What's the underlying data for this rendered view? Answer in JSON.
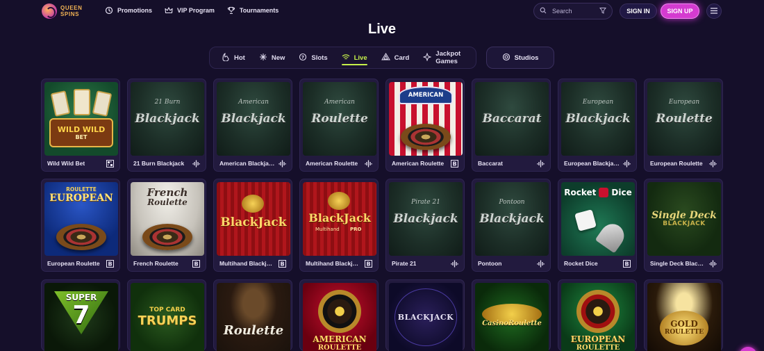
{
  "header": {
    "logo_line1": "QUEEN",
    "logo_line2": "SPINS",
    "nav": [
      {
        "label": "Promotions",
        "icon": "promotions-icon"
      },
      {
        "label": "VIP Program",
        "icon": "crown-icon"
      },
      {
        "label": "Tournaments",
        "icon": "trophy-icon"
      }
    ],
    "search_placeholder": "Search",
    "sign_in": "SIGN IN",
    "sign_up": "SIGN UP"
  },
  "page_title": "Live",
  "categories": [
    {
      "label": "Hot",
      "icon": "hot-icon"
    },
    {
      "label": "New",
      "icon": "new-icon"
    },
    {
      "label": "Slots",
      "icon": "slots-icon"
    },
    {
      "label": "Live",
      "icon": "live-icon",
      "active": true
    },
    {
      "label": "Card",
      "icon": "card-icon"
    },
    {
      "label": "Jackpot Games",
      "icon": "jackpot-icon"
    }
  ],
  "studios_label": "Studios",
  "games_row1": [
    {
      "name": "Wild Wild Bet",
      "provider_icon": "qr-icon"
    },
    {
      "name": "21 Burn Blackjack",
      "provider_icon": "evolution-icon"
    },
    {
      "name": "American Blackjack",
      "provider_icon": "evolution-icon"
    },
    {
      "name": "American Roulette",
      "provider_icon": "evolution-icon"
    },
    {
      "name": "American Roulette",
      "provider_icon": "b-icon"
    },
    {
      "name": "Baccarat",
      "provider_icon": "evolution-icon"
    },
    {
      "name": "European Blackjack",
      "provider_icon": "evolution-icon"
    },
    {
      "name": "European Roulette",
      "provider_icon": "evolution-icon"
    }
  ],
  "games_row2": [
    {
      "name": "European Roulette",
      "provider_icon": "b-icon"
    },
    {
      "name": "French Roulette",
      "provider_icon": "b-icon"
    },
    {
      "name": "Multihand Blackjack",
      "provider_icon": "b-icon"
    },
    {
      "name": "Multihand Blackjack Pro",
      "provider_icon": "b-icon"
    },
    {
      "name": "Pirate 21",
      "provider_icon": "evolution-icon"
    },
    {
      "name": "Pontoon",
      "provider_icon": "evolution-icon"
    },
    {
      "name": "Rocket Dice",
      "provider_icon": "b-icon"
    },
    {
      "name": "Single Deck Blackjack",
      "provider_icon": "evolution-icon"
    }
  ],
  "thumbs": {
    "wild_wild_bet": [
      "WILD WILD",
      "BET"
    ],
    "burn21": [
      "21 Burn",
      "Blackjack"
    ],
    "american_blackjack": [
      "American",
      "Blackjack"
    ],
    "american_roulette_felt": [
      "American",
      "Roulette"
    ],
    "american_roulette_b": "AMERICAN",
    "baccarat": "Baccarat",
    "european_blackjack": [
      "European",
      "Blackjack"
    ],
    "european_roulette_felt": [
      "European",
      "Roulette"
    ],
    "european_roulette_b": [
      "ROULETTE",
      "EUROPEAN"
    ],
    "french_roulette": [
      "French",
      "Roulette"
    ],
    "multihand_blackjack": "BlackJack",
    "multihand_pro": [
      "BlackJack",
      "Multihand",
      "PRO"
    ],
    "pirate21": [
      "Pirate 21",
      "Blackjack"
    ],
    "pontoon": [
      "Pontoon",
      "Blackjack"
    ],
    "rocket_dice": [
      "Rocket",
      "Dice"
    ],
    "single_deck": [
      "Single Deck",
      "BLACKJACK"
    ],
    "super7": [
      "SUPER",
      "7"
    ],
    "trumps": [
      "TOP CARD",
      "TRUMPS"
    ],
    "roulette_partial": "Roulette",
    "american_roulette_red": [
      "AMERICAN",
      "ROULETTE"
    ],
    "blackjack_dark": "BLACKJACK",
    "casino_roulette": "CasinoRoulette",
    "european_roulette_red": [
      "EUROPEAN",
      "ROULETTE"
    ],
    "gold_roulette": [
      "GOLD",
      "ROULETTE"
    ]
  }
}
